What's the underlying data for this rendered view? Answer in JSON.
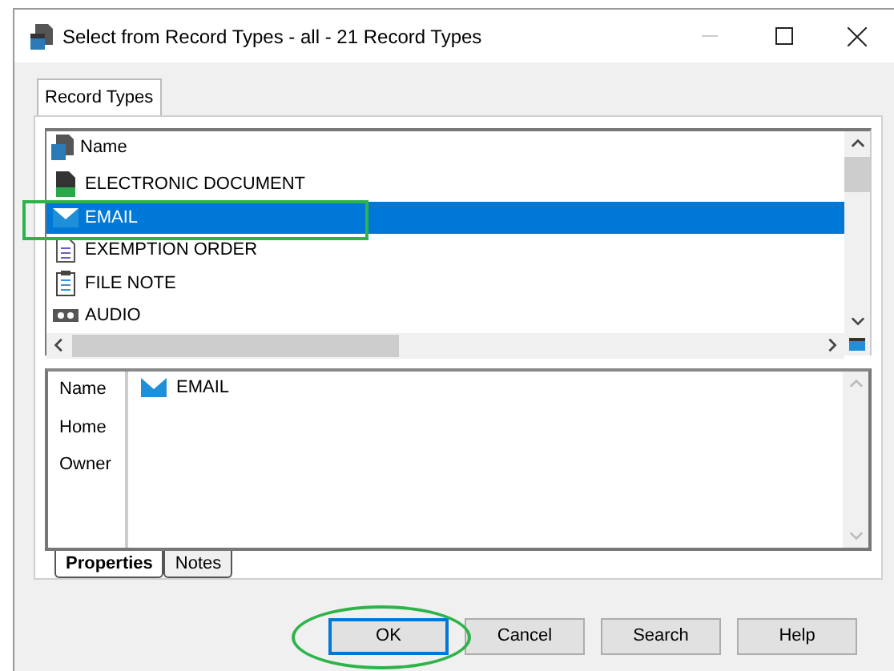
{
  "window": {
    "title": "Select from Record Types - all - 21 Record Types"
  },
  "tabs": [
    {
      "label": "Record Types",
      "selected": true
    }
  ],
  "list": {
    "column": "Name",
    "rows": [
      {
        "label": "ELECTRONIC DOCUMENT",
        "kind": "document",
        "selected": false
      },
      {
        "label": "EMAIL",
        "kind": "email",
        "selected": true
      },
      {
        "label": "EXEMPTION ORDER",
        "kind": "order",
        "selected": false
      },
      {
        "label": "FILE NOTE",
        "kind": "note",
        "selected": false
      },
      {
        "label": "AUDIO",
        "kind": "audio",
        "selected": false
      }
    ]
  },
  "properties": {
    "fields": [
      {
        "label": "Name",
        "value": "EMAIL",
        "kind": "email"
      },
      {
        "label": "Home"
      },
      {
        "label": "Owner"
      }
    ]
  },
  "bottom_tabs": [
    {
      "label": "Properties",
      "selected": true
    },
    {
      "label": "Notes",
      "selected": false
    }
  ],
  "buttons": [
    {
      "label": "OK",
      "default": true
    },
    {
      "label": "Cancel",
      "default": false
    },
    {
      "label": "Search",
      "default": false
    },
    {
      "label": "Help",
      "default": false
    }
  ]
}
